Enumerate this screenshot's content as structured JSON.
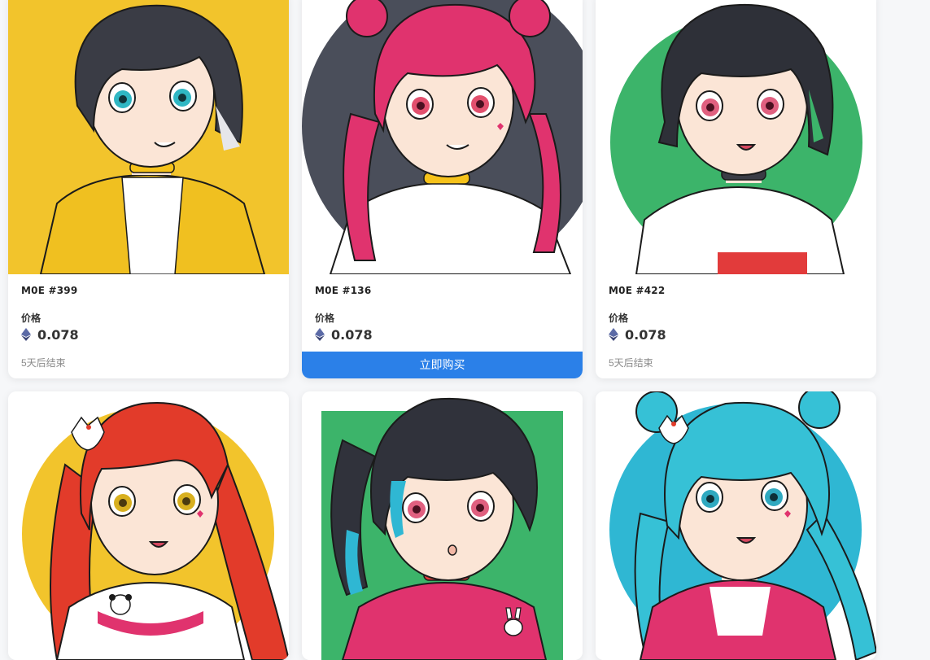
{
  "colors": {
    "accent": "#2b80e8",
    "card_bg": "#ffffff",
    "page_bg": "#f6f7f9"
  },
  "cards": [
    {
      "name": "M0E #399",
      "price_label": "价格",
      "price": "0.078",
      "status": "5天后结束",
      "bg": "#f2c42c",
      "hair": "#3a3c45",
      "eyes": "#2fb7c4"
    },
    {
      "name": "M0E #136",
      "price_label": "价格",
      "price": "0.078",
      "buy_label": "立即购买",
      "bg": "#4a4e5a",
      "hair": "#e0336e",
      "eyes": "#e2506e"
    },
    {
      "name": "M0E #422",
      "price_label": "价格",
      "price": "0.078",
      "status": "5天后结束",
      "bg": "#3cb46a",
      "hair": "#2e3038",
      "eyes": "#e06080"
    },
    {
      "bg": "#f2c42c",
      "hair": "#e23b2a",
      "eyes": "#d8b020"
    },
    {
      "bg": "#3cb46a",
      "hair": "#30323b",
      "eyes": "#e06080"
    },
    {
      "bg": "#2fb7d3",
      "hair": "#2fb7d3",
      "eyes": "#2fa9c0"
    }
  ]
}
